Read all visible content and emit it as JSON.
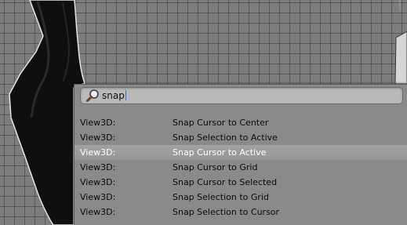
{
  "viewport": {
    "background": "#7d7d7d",
    "grid_color": "#505050",
    "object_color": "#0f0f0f",
    "object_edge_color": "#e6e6e6"
  },
  "search": {
    "icon": "magnifier-icon",
    "query": "snap",
    "accent": "#3b6bd6"
  },
  "results": [
    {
      "context": "View3D:",
      "name": "Snap Cursor to Center",
      "active": false
    },
    {
      "context": "View3D:",
      "name": "Snap Selection to Active",
      "active": false
    },
    {
      "context": "View3D:",
      "name": "Snap Cursor to Active",
      "active": true
    },
    {
      "context": "View3D:",
      "name": "Snap Cursor to Grid",
      "active": false
    },
    {
      "context": "View3D:",
      "name": "Snap Cursor to Selected",
      "active": false
    },
    {
      "context": "View3D:",
      "name": "Snap Selection to Grid",
      "active": false
    },
    {
      "context": "View3D:",
      "name": "Snap Selection to Cursor",
      "active": false
    }
  ]
}
